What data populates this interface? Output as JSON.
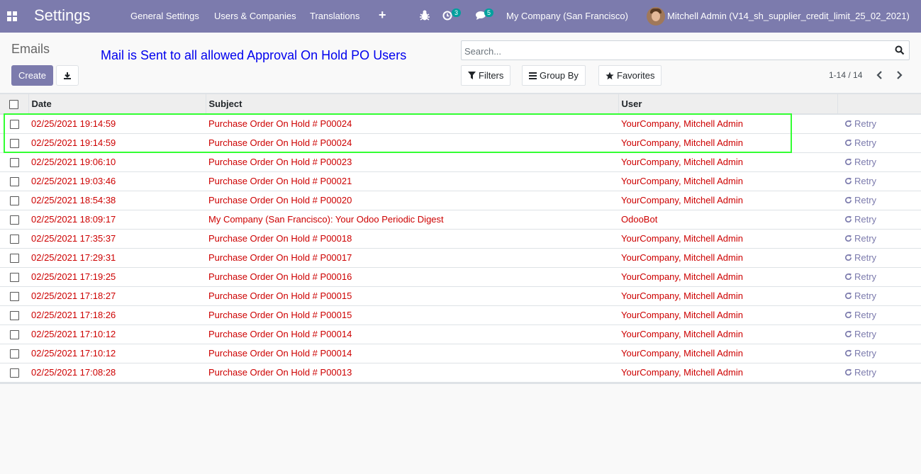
{
  "navbar": {
    "apps_icon": "apps-grid-icon",
    "brand": "Settings",
    "menu": [
      "General Settings",
      "Users & Companies",
      "Translations"
    ],
    "plus_label": "+",
    "activity_count": "3",
    "messages_count": "5",
    "company": "My Company (San Francisco)",
    "user": "Mitchell Admin (V14_sh_supplier_credit_limit_25_02_2021)"
  },
  "control_panel": {
    "title": "Emails",
    "annotation": "Mail is Sent to all allowed Approval On Hold PO Users",
    "create_label": "Create",
    "search_placeholder": "Search...",
    "filters_label": "Filters",
    "group_by_label": "Group By",
    "favorites_label": "Favorites",
    "pager": "1-14 / 14"
  },
  "table": {
    "headers": {
      "date": "Date",
      "subject": "Subject",
      "user": "User"
    },
    "retry_label": "Retry",
    "rows": [
      {
        "date": "02/25/2021 19:14:59",
        "subject": "Purchase Order On Hold # P00024",
        "user": "YourCompany, Mitchell Admin"
      },
      {
        "date": "02/25/2021 19:14:59",
        "subject": "Purchase Order On Hold # P00024",
        "user": "YourCompany, Mitchell Admin"
      },
      {
        "date": "02/25/2021 19:06:10",
        "subject": "Purchase Order On Hold # P00023",
        "user": "YourCompany, Mitchell Admin"
      },
      {
        "date": "02/25/2021 19:03:46",
        "subject": "Purchase Order On Hold # P00021",
        "user": "YourCompany, Mitchell Admin"
      },
      {
        "date": "02/25/2021 18:54:38",
        "subject": "Purchase Order On Hold # P00020",
        "user": "YourCompany, Mitchell Admin"
      },
      {
        "date": "02/25/2021 18:09:17",
        "subject": "My Company (San Francisco): Your Odoo Periodic Digest",
        "user": "OdooBot"
      },
      {
        "date": "02/25/2021 17:35:37",
        "subject": "Purchase Order On Hold # P00018",
        "user": "YourCompany, Mitchell Admin"
      },
      {
        "date": "02/25/2021 17:29:31",
        "subject": "Purchase Order On Hold # P00017",
        "user": "YourCompany, Mitchell Admin"
      },
      {
        "date": "02/25/2021 17:19:25",
        "subject": "Purchase Order On Hold # P00016",
        "user": "YourCompany, Mitchell Admin"
      },
      {
        "date": "02/25/2021 17:18:27",
        "subject": "Purchase Order On Hold # P00015",
        "user": "YourCompany, Mitchell Admin"
      },
      {
        "date": "02/25/2021 17:18:26",
        "subject": "Purchase Order On Hold # P00015",
        "user": "YourCompany, Mitchell Admin"
      },
      {
        "date": "02/25/2021 17:10:12",
        "subject": "Purchase Order On Hold # P00014",
        "user": "YourCompany, Mitchell Admin"
      },
      {
        "date": "02/25/2021 17:10:12",
        "subject": "Purchase Order On Hold # P00014",
        "user": "YourCompany, Mitchell Admin"
      },
      {
        "date": "02/25/2021 17:08:28",
        "subject": "Purchase Order On Hold # P00013",
        "user": "YourCompany, Mitchell Admin"
      }
    ]
  },
  "colors": {
    "navbar": "#7c7bad",
    "row_text": "#cd0000",
    "annotation": "#0000ee",
    "highlight": "#33ff33"
  }
}
